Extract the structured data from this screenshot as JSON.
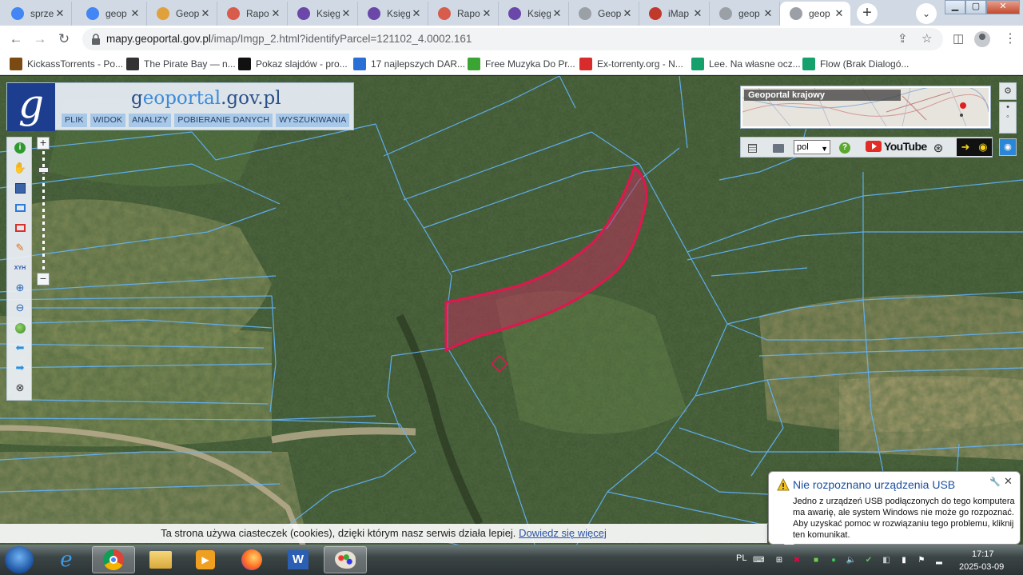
{
  "tabs": [
    {
      "title": "sprze",
      "favicon": "google-icon",
      "color": "#4285f4"
    },
    {
      "title": "geop",
      "favicon": "google-icon",
      "color": "#4285f4"
    },
    {
      "title": "Geop",
      "favicon": "geoportal-rainbow-icon",
      "color": "#e0a03c"
    },
    {
      "title": "Rapo",
      "favicon": "stack-icon",
      "color": "#d85c4c"
    },
    {
      "title": "Księg",
      "favicon": "paragraph-icon",
      "color": "#6a47a8"
    },
    {
      "title": "Księg",
      "favicon": "paragraph-icon",
      "color": "#6a47a8"
    },
    {
      "title": "Rapo",
      "favicon": "stack-icon",
      "color": "#d85c4c"
    },
    {
      "title": "Księg",
      "favicon": "paragraph-icon",
      "color": "#6a47a8"
    },
    {
      "title": "Geop",
      "favicon": "geoportal-g-icon",
      "color": "#9aa0a6"
    },
    {
      "title": "iMap",
      "favicon": "imap-icon",
      "color": "#c0392b"
    },
    {
      "title": "geop",
      "favicon": "geoportal-g-icon",
      "color": "#9aa0a6"
    },
    {
      "title": "geop",
      "favicon": "geoportal-g-icon",
      "color": "#9aa0a6",
      "active": true
    }
  ],
  "address": {
    "host": "mapy.geoportal.gov.pl",
    "path": "/imap/Imgp_2.html?identifyParcel=121102_4.0002.161"
  },
  "bookmarks": [
    {
      "label": "KickassTorrents - Po...",
      "icon": "kat-icon",
      "color": "#7a4a12"
    },
    {
      "label": "The Pirate Bay — n...",
      "icon": "pirate-ship-icon",
      "color": "#333333"
    },
    {
      "label": "Pokaz slajdów - pro...",
      "icon": "k-logo-icon",
      "color": "#111111"
    },
    {
      "label": "17 najlepszych DAR...",
      "icon": "blue-app-icon",
      "color": "#2a6fd6"
    },
    {
      "label": "Free Muzyka Do Pr...",
      "icon": "px-icon",
      "color": "#3ba534"
    },
    {
      "label": "Ex-torrenty.org - N...",
      "icon": "ex-icon",
      "color": "#d92b2b"
    },
    {
      "label": "Lee. Na własne ocz...",
      "icon": "green-doc-icon",
      "color": "#16a06b"
    },
    {
      "label": "Flow (Brak Dialogó...",
      "icon": "green-doc-icon",
      "color": "#16a06b"
    }
  ],
  "geoportal": {
    "logo_letter": "g",
    "logo_text_a": "g",
    "logo_text_b": "eoportal",
    "logo_text_c": ".gov.pl",
    "menu": [
      "PLIK",
      "WIDOK",
      "ANALIZY",
      "POBIERANIE DANYCH",
      "WYSZUKIWANIA"
    ],
    "overview_label": "Geoportal krajowy",
    "language": "pol",
    "youtube_label": "YouTube",
    "xyh_label": "XYH",
    "parcel_fill": "#b8325a",
    "parcel_stroke": "#e0164f",
    "parcel_lines_color": "#62b4ff"
  },
  "cookie": {
    "text": "Ta strona używa ciasteczek (cookies), dzięki którym nasz serwis działa lepiej.",
    "link": "Dowiedz się więcej"
  },
  "usb": {
    "title": "Nie rozpoznano urządzenia USB",
    "body": "Jedno z urządzeń USB podłączonych do tego komputera ma awarię, ale system Windows nie może go rozpoznać. Aby uzyskać pomoc w rozwiązaniu tego problemu, kliknij ten komunikat."
  },
  "taskbar": {
    "language": "PL",
    "time": "17:17",
    "date": "2025-03-09"
  }
}
